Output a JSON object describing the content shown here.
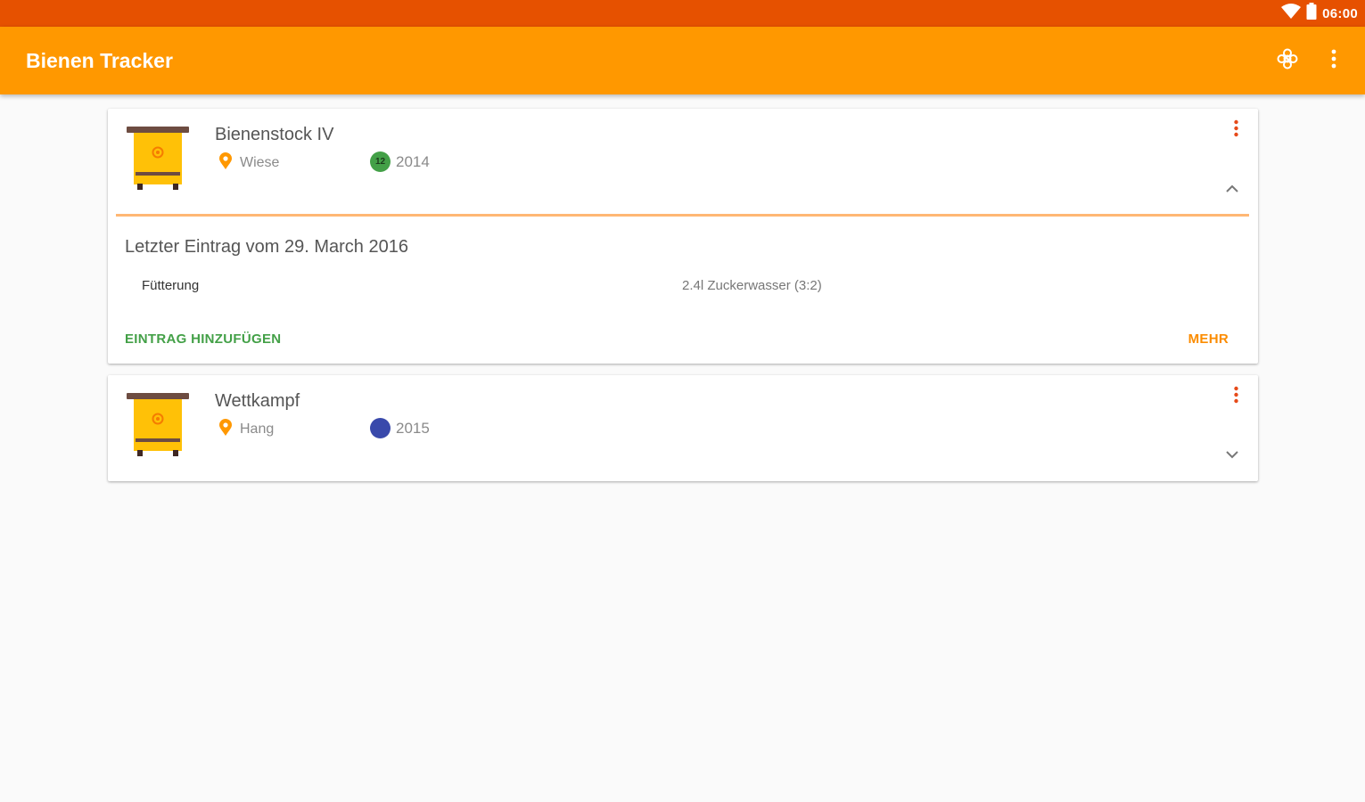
{
  "status_bar": {
    "time": "06:00",
    "icons": [
      "wifi-icon",
      "battery-icon"
    ]
  },
  "app_bar": {
    "title": "Bienen Tracker",
    "actions": [
      "flower-settings-icon",
      "more-vert-icon"
    ]
  },
  "hives": [
    {
      "name": "Bienenstock IV",
      "location": "Wiese",
      "queen_number": "12",
      "queen_color": "#43a047",
      "year": "2014",
      "expanded": true,
      "last_entry": "Letzter Eintrag vom 29. March 2016",
      "entry_label": "Fütterung",
      "entry_value": "2.4l Zuckerwasser (3:2)",
      "add_entry_label": "EINTRAG HINZUFÜGEN",
      "more_label": "MEHR"
    },
    {
      "name": "Wettkampf",
      "location": "Hang",
      "queen_number": "",
      "queen_color": "#3949ab",
      "year": "2015",
      "expanded": false
    }
  ],
  "colors": {
    "status_bar": "#e65100",
    "app_bar": "#ff9800",
    "accent_orange": "#fb8c00",
    "menu_red": "#e64a19",
    "add_green": "#43a047"
  }
}
